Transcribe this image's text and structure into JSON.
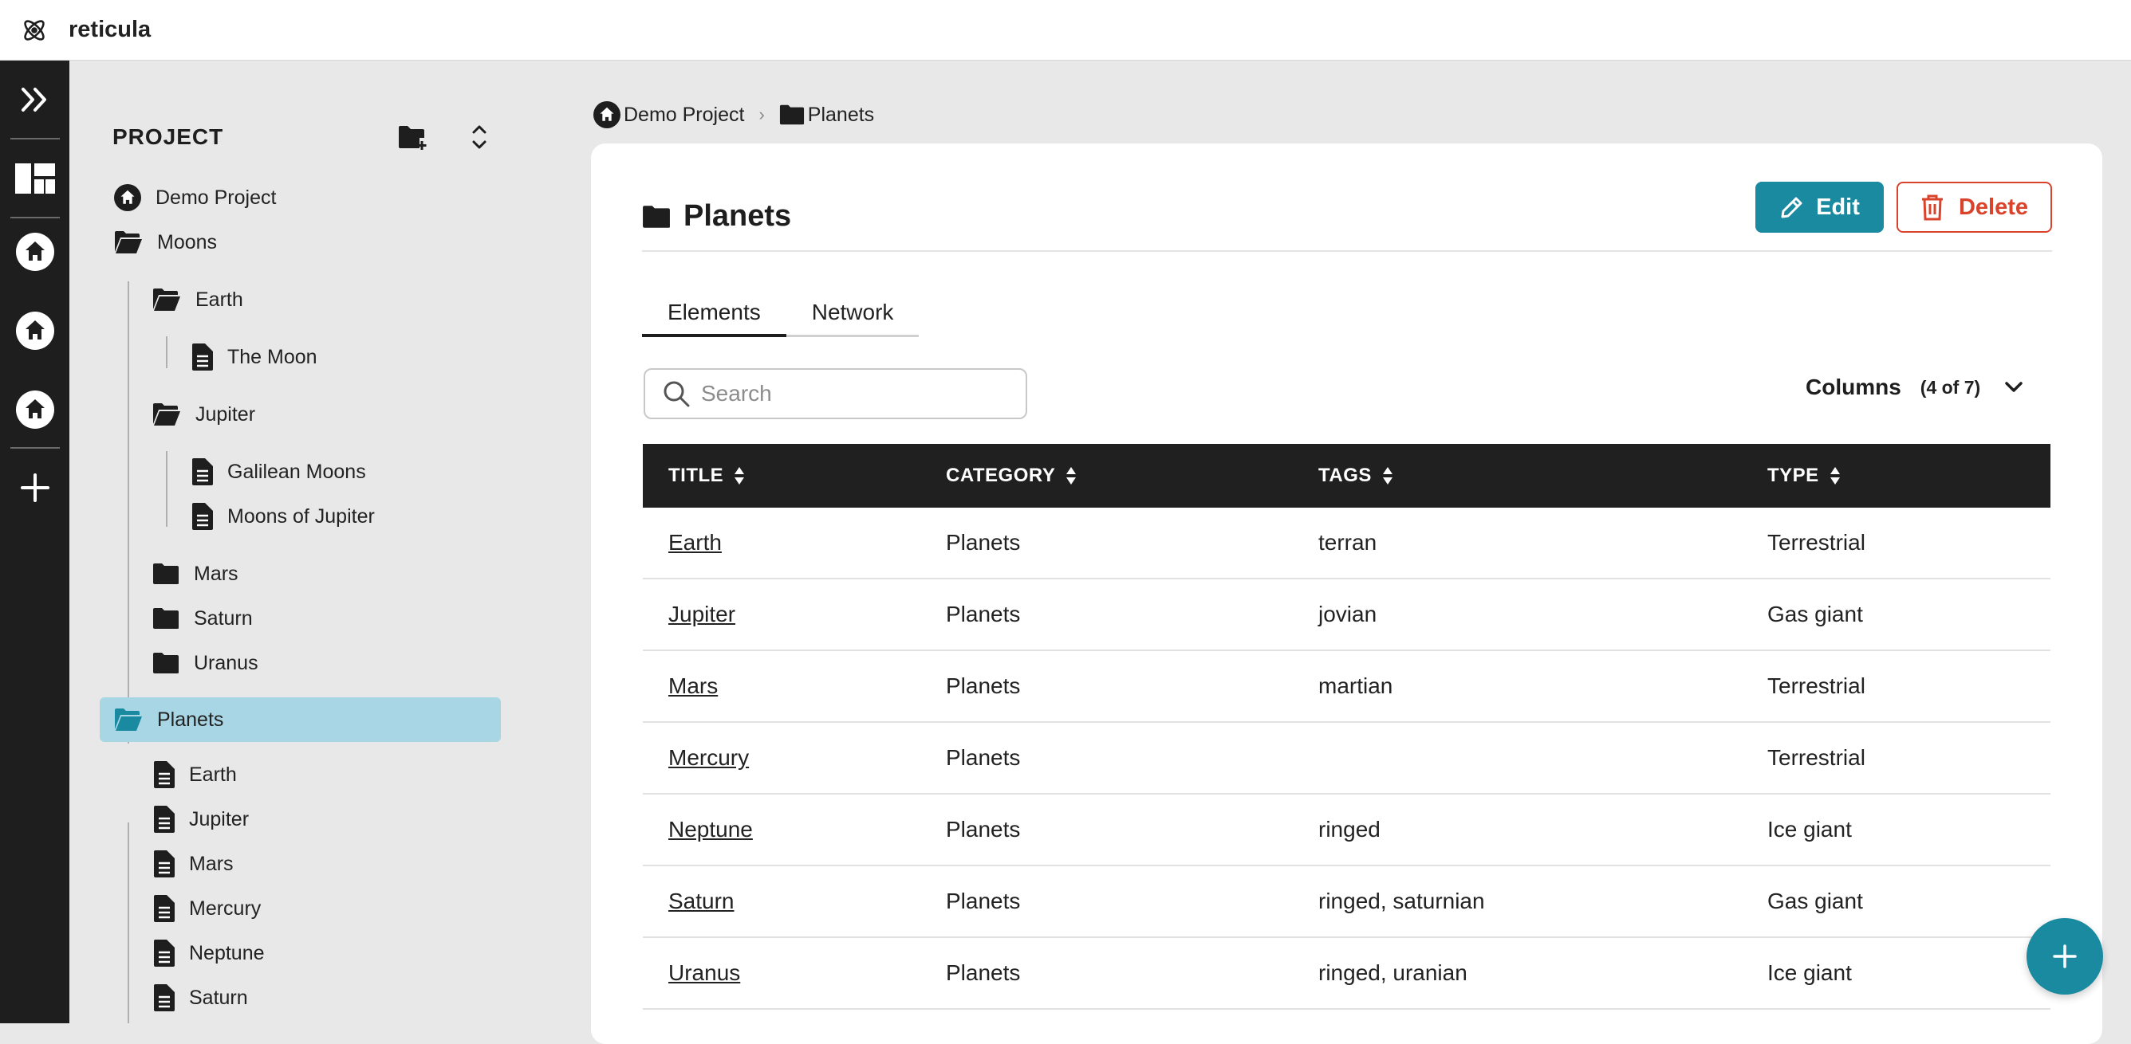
{
  "app": {
    "name": "reticula",
    "logo_icon": "atom-icon"
  },
  "rail": {
    "items": [
      {
        "icon": "expand-sidebar-icon"
      },
      {
        "icon": "dashboard-icon"
      },
      {
        "icon": "home-icon"
      },
      {
        "icon": "home-icon"
      },
      {
        "icon": "home-icon"
      },
      {
        "icon": "plus-icon"
      }
    ]
  },
  "sidebar": {
    "title": "PROJECT",
    "tree": [
      {
        "label": "Demo Project",
        "icon": "home-icon",
        "level": 0
      },
      {
        "label": "Moons",
        "icon": "folder-open-icon",
        "level": 0
      },
      {
        "label": "Earth",
        "icon": "folder-open-icon",
        "level": 1
      },
      {
        "label": "The Moon",
        "icon": "document-icon",
        "level": 2
      },
      {
        "label": "Jupiter",
        "icon": "folder-open-icon",
        "level": 1
      },
      {
        "label": "Galilean Moons",
        "icon": "document-icon",
        "level": 2
      },
      {
        "label": "Moons of Jupiter",
        "icon": "document-icon",
        "level": 2
      },
      {
        "label": "Mars",
        "icon": "folder-icon",
        "level": 1
      },
      {
        "label": "Saturn",
        "icon": "folder-icon",
        "level": 1
      },
      {
        "label": "Uranus",
        "icon": "folder-icon",
        "level": 1
      },
      {
        "label": "Planets",
        "icon": "folder-open-icon",
        "level": 0,
        "selected": true
      },
      {
        "label": "Earth",
        "icon": "document-icon",
        "level": 1
      },
      {
        "label": "Jupiter",
        "icon": "document-icon",
        "level": 1
      },
      {
        "label": "Mars",
        "icon": "document-icon",
        "level": 1
      },
      {
        "label": "Mercury",
        "icon": "document-icon",
        "level": 1
      },
      {
        "label": "Neptune",
        "icon": "document-icon",
        "level": 1
      },
      {
        "label": "Saturn",
        "icon": "document-icon",
        "level": 1
      }
    ]
  },
  "breadcrumb": [
    {
      "label": "Demo Project",
      "icon": "home-icon"
    },
    {
      "label": "Planets",
      "icon": "folder-icon"
    }
  ],
  "main": {
    "title": "Planets",
    "edit_label": "Edit",
    "delete_label": "Delete",
    "tabs": [
      {
        "label": "Elements",
        "active": true
      },
      {
        "label": "Network",
        "active": false
      }
    ],
    "search": {
      "placeholder": "Search",
      "value": ""
    },
    "columns": {
      "label": "Columns",
      "count": "(4 of 7)"
    },
    "table": {
      "headers": [
        "TITLE",
        "CATEGORY",
        "TAGS",
        "TYPE"
      ],
      "rows": [
        [
          "Earth",
          "Planets",
          "terran",
          "Terrestrial"
        ],
        [
          "Jupiter",
          "Planets",
          "jovian",
          "Gas giant"
        ],
        [
          "Mars",
          "Planets",
          "martian",
          "Terrestrial"
        ],
        [
          "Mercury",
          "Planets",
          "",
          "Terrestrial"
        ],
        [
          "Neptune",
          "Planets",
          "ringed",
          "Ice giant"
        ],
        [
          "Saturn",
          "Planets",
          "ringed, saturnian",
          "Gas giant"
        ],
        [
          "Uranus",
          "Planets",
          "ringed, uranian",
          "Ice giant"
        ]
      ]
    }
  },
  "colors": {
    "accent": "#1a8aa0",
    "danger": "#d9432b",
    "selected": "#a9d6e5",
    "rail": "#1e1e1e"
  }
}
